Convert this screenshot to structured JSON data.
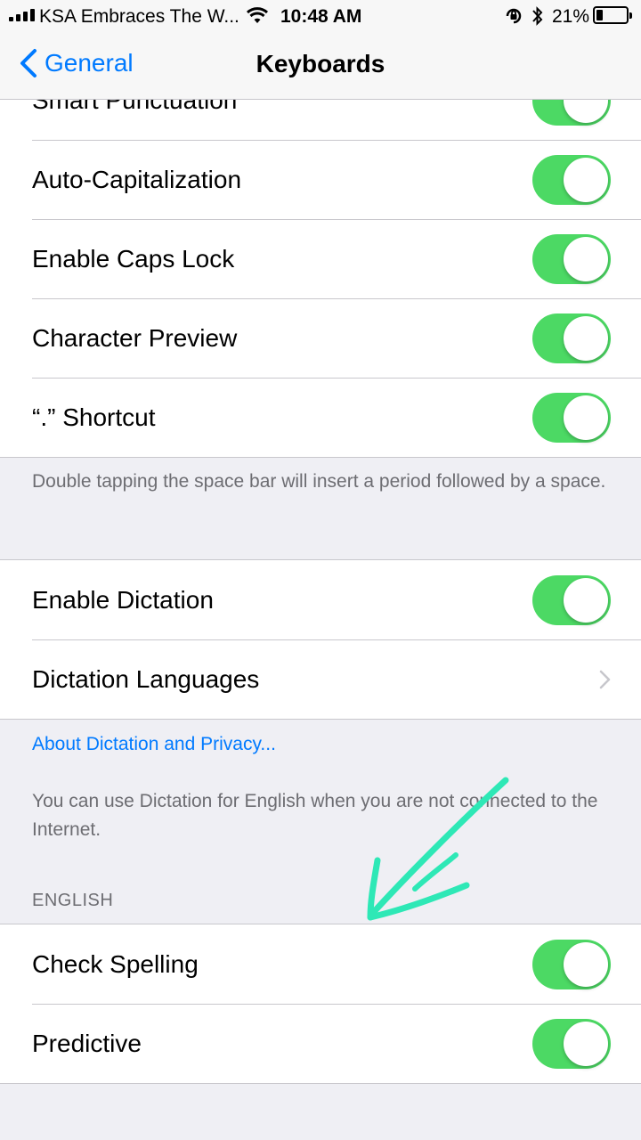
{
  "status_bar": {
    "carrier": "KSA Embraces The W...",
    "time": "10:48 AM",
    "battery_percent": "21%",
    "battery_level": 0.21,
    "icons": [
      "signal-icon",
      "wifi-icon",
      "orientation-lock-icon",
      "bluetooth-icon",
      "battery-icon"
    ]
  },
  "nav": {
    "back_label": "General",
    "title": "Keyboards"
  },
  "group1": {
    "rows": [
      {
        "label": "Smart Punctuation",
        "on": true
      },
      {
        "label": "Auto-Capitalization",
        "on": true
      },
      {
        "label": "Enable Caps Lock",
        "on": true
      },
      {
        "label": "Character Preview",
        "on": true
      },
      {
        "label": "“.” Shortcut",
        "on": true
      }
    ],
    "footer": "Double tapping the space bar will insert a period followed by a space."
  },
  "group2": {
    "rows": [
      {
        "label": "Enable Dictation",
        "on": true
      },
      {
        "label": "Dictation Languages"
      }
    ],
    "link": "About Dictation and Privacy...",
    "footer": "You can use Dictation for English when you are not connected to the Internet."
  },
  "english": {
    "header": "ENGLISH",
    "rows": [
      {
        "label": "Check Spelling",
        "on": true
      },
      {
        "label": "Predictive",
        "on": true
      }
    ]
  },
  "colors": {
    "accent": "#007aff",
    "toggle_on": "#4cd964",
    "annotation": "#2ee8b6",
    "background": "#efeff4"
  }
}
